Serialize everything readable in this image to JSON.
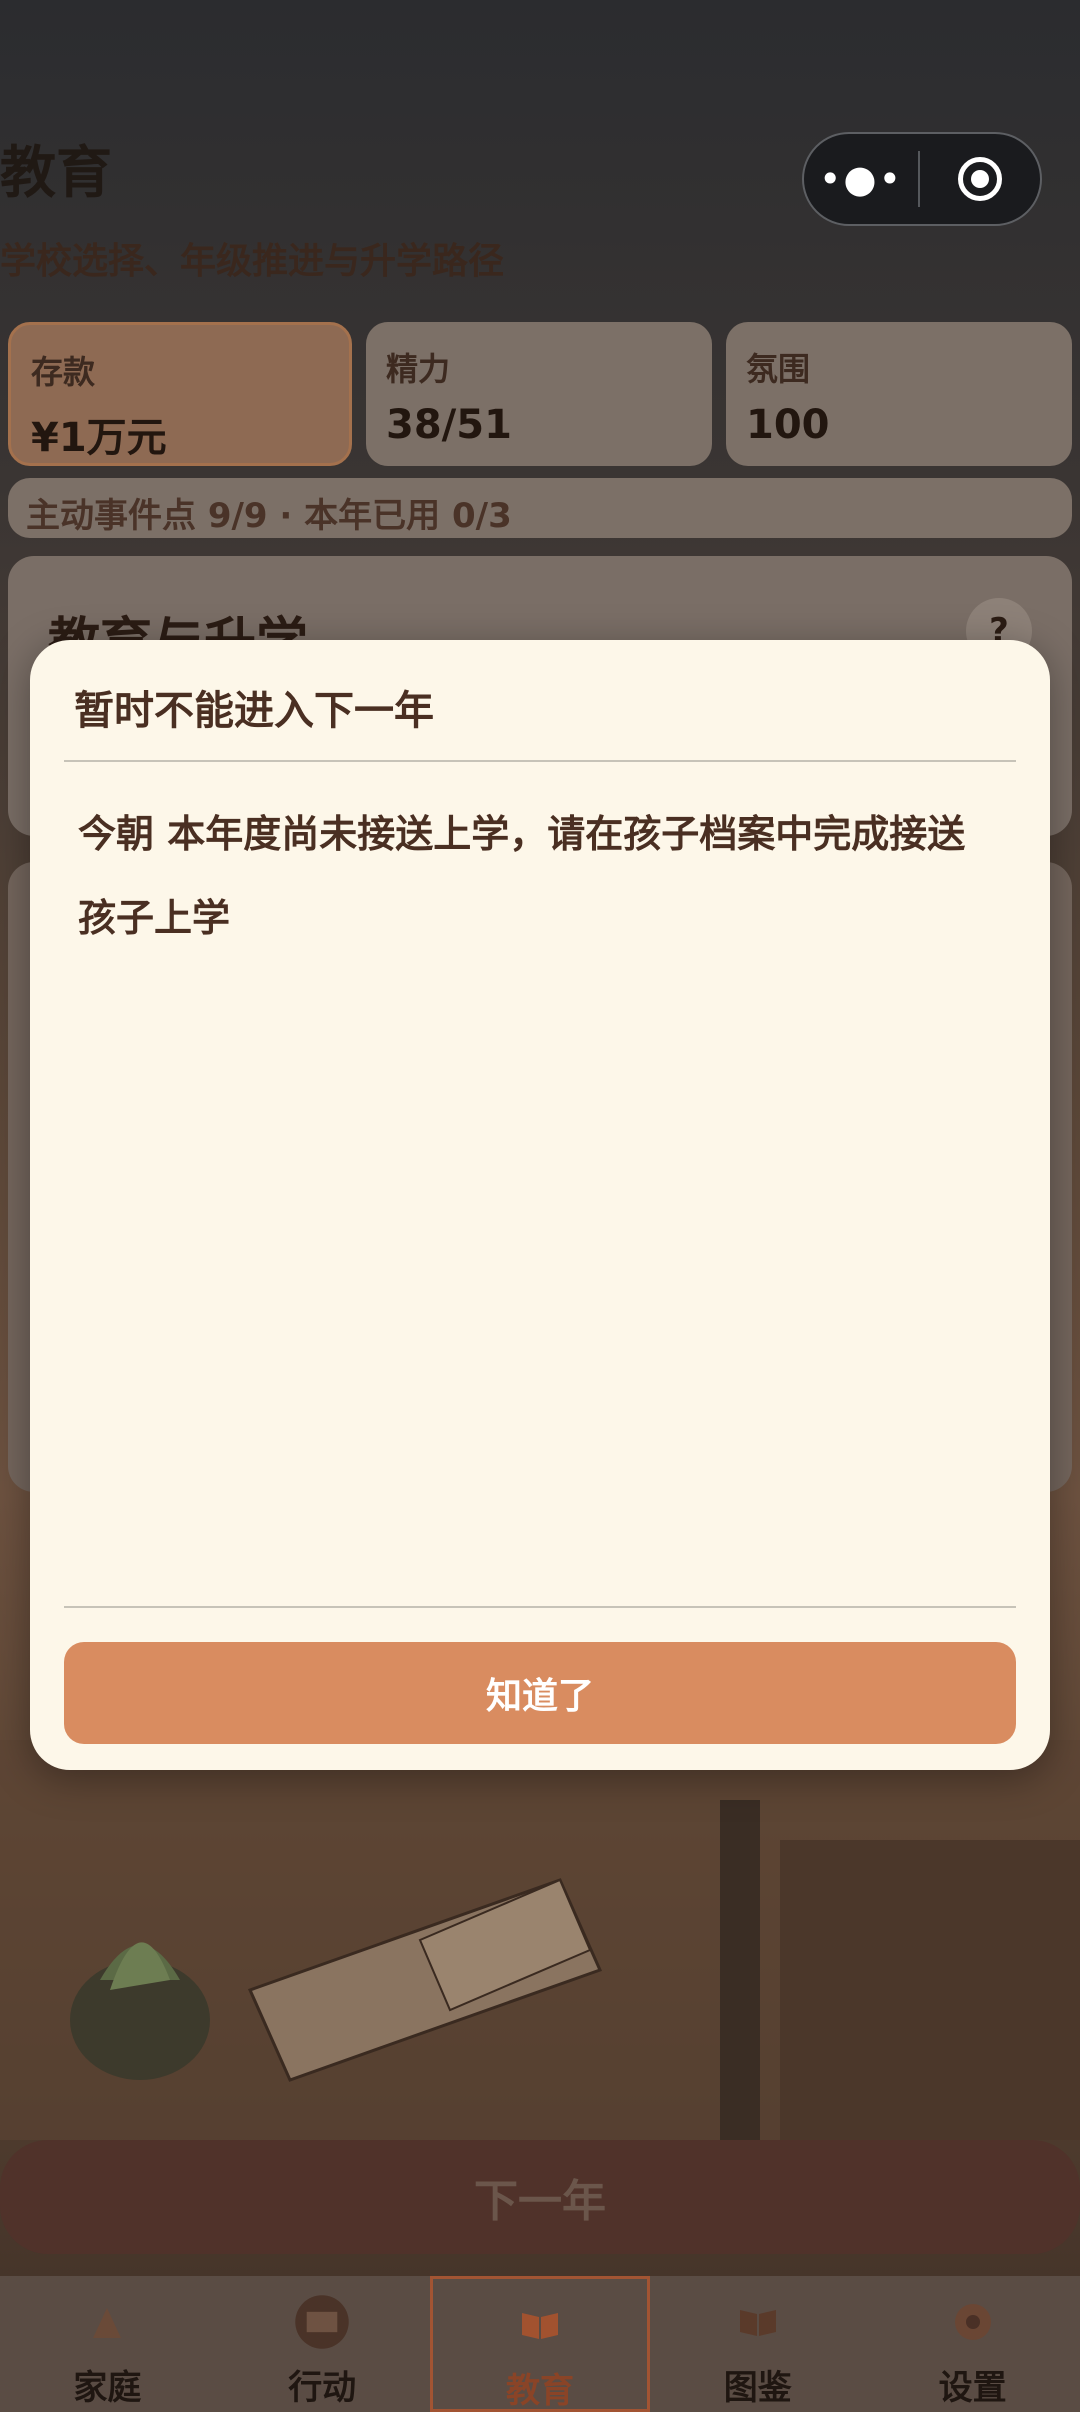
{
  "header": {
    "title": "教育",
    "subtitle": "学校选择、年级推进与升学路径"
  },
  "stats": [
    {
      "label": "存款",
      "value": "¥1万元"
    },
    {
      "label": "精力",
      "value": "38/51"
    },
    {
      "label": "氛围",
      "value": "100"
    }
  ],
  "events_text": "主动事件点 9/9 · 本年已用 0/3",
  "edu_card": {
    "title": "教育与升学",
    "help": "?"
  },
  "next_year_label": "下一年",
  "tabs": [
    {
      "label": "家庭",
      "icon": "family-icon"
    },
    {
      "label": "行动",
      "icon": "action-icon"
    },
    {
      "label": "教育",
      "icon": "book-icon",
      "active": true
    },
    {
      "label": "图鉴",
      "icon": "catalog-icon"
    },
    {
      "label": "设置",
      "icon": "settings-icon"
    }
  ],
  "modal": {
    "title": "暂时不能进入下一年",
    "message": "今朝 本年度尚未接送上学，请在孩子档案中完成接送孩子上学",
    "button": "知道了"
  },
  "colors": {
    "accent": "#d98c60",
    "modal_bg": "#fdf7e9",
    "text_brown": "#4a2f22"
  }
}
